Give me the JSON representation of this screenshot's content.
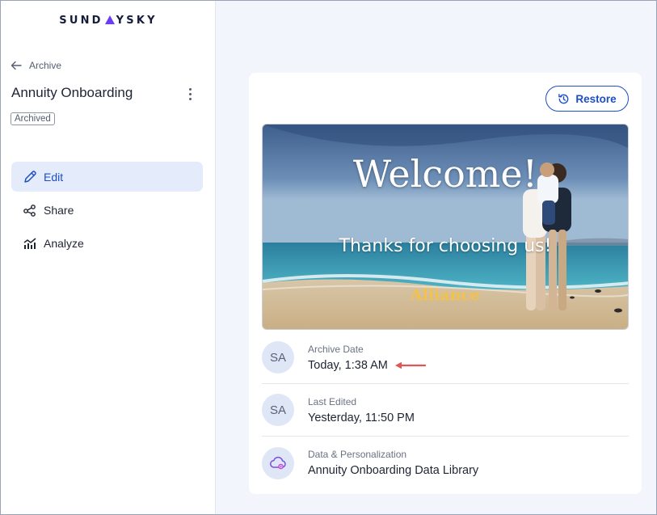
{
  "brand": {
    "logo_left": "SUND",
    "logo_right": "YSKY",
    "accent_color": "#6b3df0"
  },
  "sidebar": {
    "back_label": "Archive",
    "project_title": "Annuity Onboarding",
    "status_badge": "Archived",
    "nav": [
      {
        "label": "Edit",
        "icon": "pencil-icon",
        "active": true
      },
      {
        "label": "Share",
        "icon": "share-icon",
        "active": false
      },
      {
        "label": "Analyze",
        "icon": "analytics-icon",
        "active": false
      }
    ]
  },
  "main": {
    "restore_label": "Restore",
    "thumbnail": {
      "title": "Welcome!",
      "subtitle": "Thanks for choosing us!",
      "brand": "Alliance"
    },
    "info": [
      {
        "avatar": "SA",
        "label": "Archive Date",
        "value": "Today, 1:38 AM",
        "annotation": "red-arrow-icon"
      },
      {
        "avatar": "SA",
        "label": "Last Edited",
        "value": "Yesterday, 11:50 PM"
      },
      {
        "avatar_icon": "cloud-data-icon",
        "label": "Data & Personalization",
        "value": "Annuity Onboarding Data Library"
      }
    ]
  },
  "colors": {
    "primary": "#1d4fc4",
    "active_nav_bg": "#e4ebfb",
    "annotation_arrow": "#e05555"
  }
}
